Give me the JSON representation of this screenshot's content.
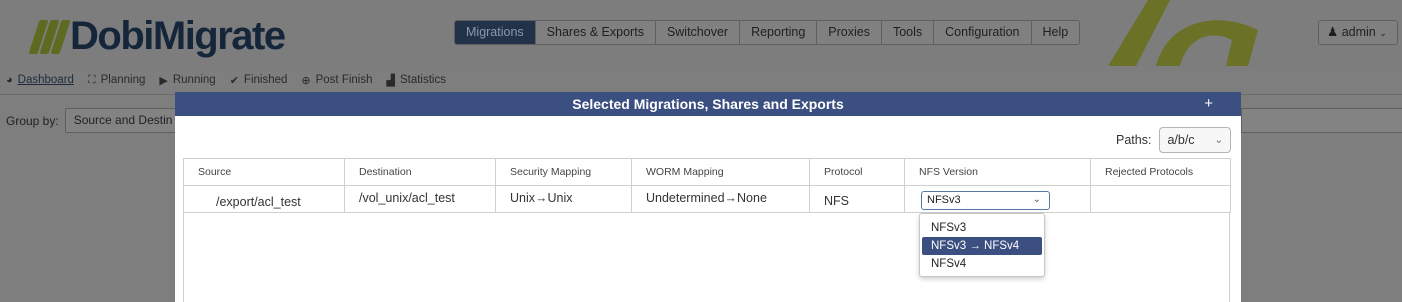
{
  "app": {
    "logo_text": "DobiMigrate"
  },
  "nav": {
    "items": [
      {
        "label": "Migrations",
        "active": true
      },
      {
        "label": "Shares & Exports"
      },
      {
        "label": "Switchover"
      },
      {
        "label": "Reporting"
      },
      {
        "label": "Proxies"
      },
      {
        "label": "Tools"
      },
      {
        "label": "Configuration"
      },
      {
        "label": "Help"
      }
    ],
    "user_label": "admin"
  },
  "subnav": {
    "items": [
      {
        "label": "Dashboard",
        "icon": "dashboard-icon",
        "glyph": "◕"
      },
      {
        "label": "Planning",
        "icon": "sitemap-icon",
        "glyph": "⛶"
      },
      {
        "label": "Running",
        "icon": "play-icon",
        "glyph": "▶"
      },
      {
        "label": "Finished",
        "icon": "check-icon",
        "glyph": "✔"
      },
      {
        "label": "Post Finish",
        "icon": "lifebuoy-icon",
        "glyph": "⊕"
      },
      {
        "label": "Statistics",
        "icon": "bar-chart-icon",
        "glyph": "▟"
      }
    ]
  },
  "groupby": {
    "label": "Group by:",
    "value": "Source and Destin"
  },
  "modal": {
    "title": "Selected Migrations, Shares and Exports",
    "add_glyph": "+",
    "paths_label": "Paths:",
    "paths_value": "a/b/c",
    "columns": [
      "Source",
      "Destination",
      "Security Mapping",
      "WORM Mapping",
      "Protocol",
      "NFS Version",
      "Rejected Protocols"
    ],
    "row": {
      "source": "/export/acl_test",
      "destination": "/vol_unix/acl_test",
      "security_mapping": "Unix→Unix",
      "worm_mapping": "Undetermined→None",
      "protocol": "NFS",
      "nfs_version": "NFSv3",
      "rejected_protocols": ""
    },
    "nfs_options": [
      {
        "label": "NFSv3",
        "selected": false
      },
      {
        "label": "NFSv3 → NFSv4",
        "selected": true
      },
      {
        "label": "NFSv4",
        "selected": false
      }
    ]
  },
  "colors": {
    "modal_header": "#3b4f80",
    "nav_active": "#223349",
    "overlay": "#7e7e7e",
    "accent_olive": "#5e6a1f"
  }
}
